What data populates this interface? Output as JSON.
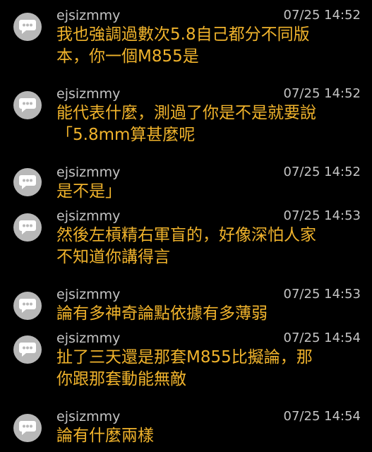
{
  "comments": [
    {
      "user": "ejsizmmy",
      "time": "07/25 14:52",
      "text": "我也強調過數次5.8自己都分不同版\n本，你一個M855是"
    },
    {
      "user": "ejsizmmy",
      "time": "07/25 14:52",
      "text": "能代表什麼，測過了你是不是就要說\n「5.8mm算甚麼呢"
    },
    {
      "user": "ejsizmmy",
      "time": "07/25 14:52",
      "text": "是不是」"
    },
    {
      "user": "ejsizmmy",
      "time": "07/25 14:53",
      "text": "然後左槓精右軍盲的，好像深怕人家\n不知道你講得言"
    },
    {
      "user": "ejsizmmy",
      "time": "07/25 14:53",
      "text": "論有多神奇論點依據有多薄弱"
    },
    {
      "user": "ejsizmmy",
      "time": "07/25 14:54",
      "text": "扯了三天還是那套M855比擬論，那\n你跟那套動能無敵"
    },
    {
      "user": "ejsizmmy",
      "time": "07/25 14:54",
      "text": "論有什麼兩樣"
    }
  ],
  "colors": {
    "background": "#000000",
    "username": "#c4c4c4",
    "timestamp": "#c4c4c4",
    "content": "#f0b32c",
    "avatar": "#b8b8b8"
  },
  "icons": {
    "avatar": "speech-bubble-icon"
  }
}
